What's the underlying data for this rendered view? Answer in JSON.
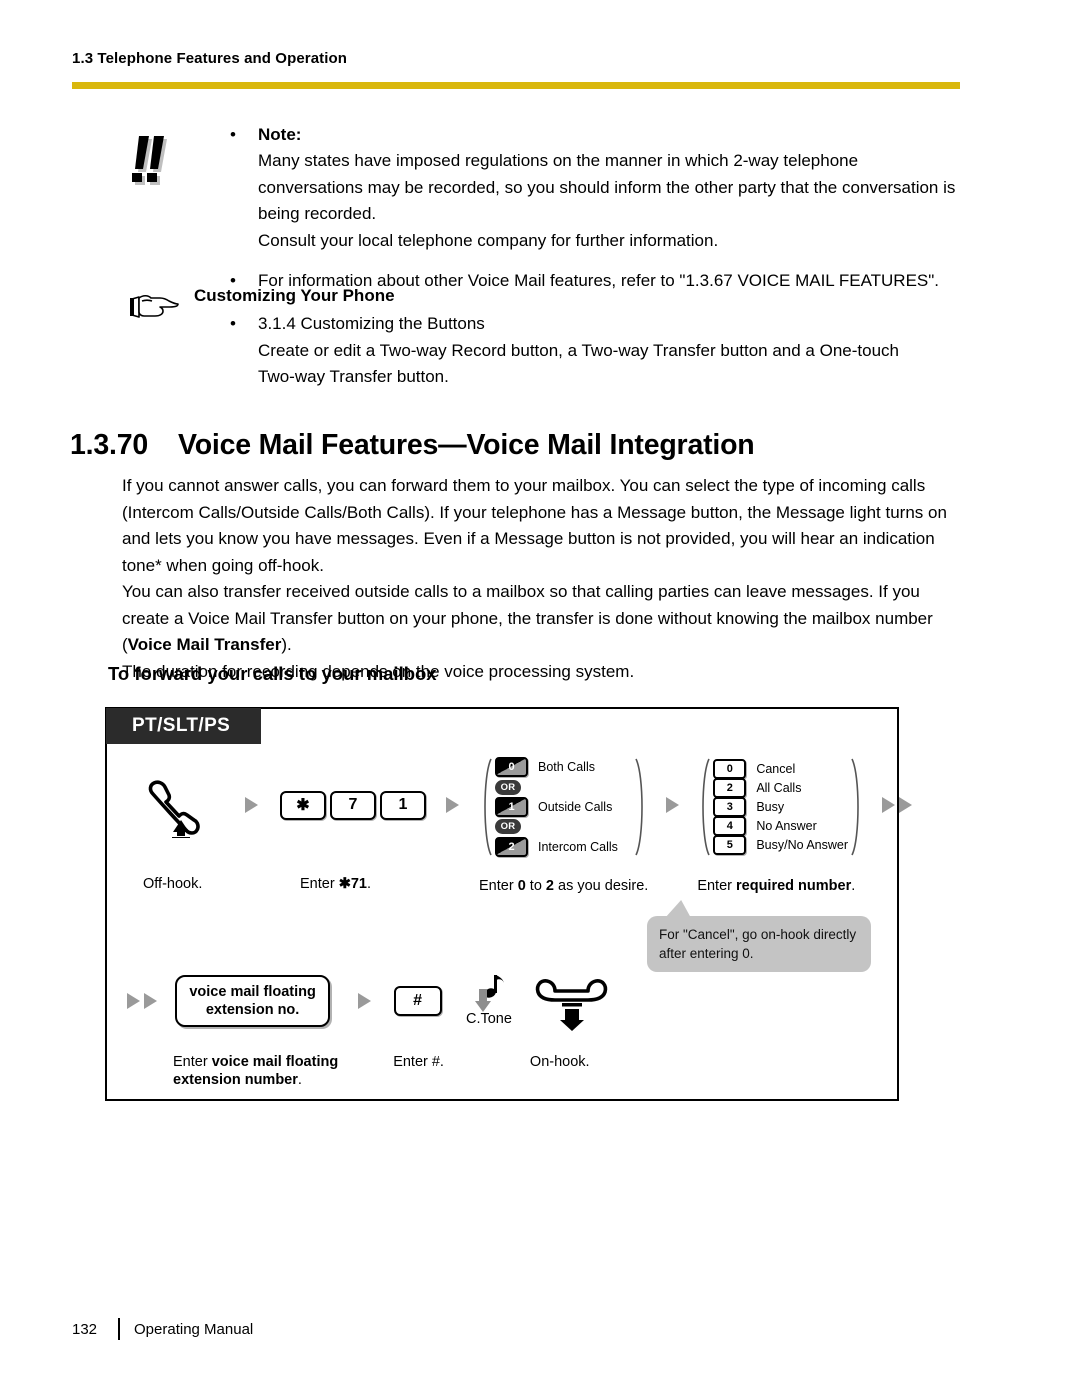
{
  "header": {
    "running_head": "1.3 Telephone Features and Operation",
    "rule_color": "#D9B70D"
  },
  "note": {
    "icon": "double-exclamation-icon",
    "bullet": "•",
    "heading": "Note:",
    "lines": [
      "Many states have imposed regulations on the manner in which 2-way telephone",
      "conversations may be recorded, so you should inform the other party that the conversation is",
      "being recorded.",
      "Consult your local telephone company for further information."
    ],
    "second_bullet": "For information about other Voice Mail features, refer to \"1.3.67 VOICE MAIL FEATURES\"."
  },
  "customizing": {
    "icon": "pointing-hand-icon",
    "heading": "Customizing Your Phone",
    "bullet": "•",
    "item": "3.1.4 Customizing the Buttons",
    "lines": [
      "Create or edit a Two-way Record button, a Two-way Transfer button and a One-touch",
      "Two-way Transfer button."
    ]
  },
  "section": {
    "number": "1.3.70",
    "title": "Voice Mail Features—Voice Mail Integration"
  },
  "intro": {
    "paragraphs": [
      "If you cannot answer calls, you can forward them to your mailbox. You can select the type of incoming calls (Intercom Calls/Outside Calls/Both Calls). If your telephone has a Message button, the Message light turns on and lets you know you have messages. Even if a Message button is not provided, you will hear an indication tone* when going off-hook.",
      "You can also transfer received outside calls to a mailbox so that calling parties can leave messages. If you create a Voice Mail Transfer button on your phone, the transfer is done without knowing the mailbox number",
      "The duration for recording depends on the voice processing system."
    ],
    "bold_term_open": "(",
    "bold_term": "Voice Mail Transfer",
    "bold_term_close": ")."
  },
  "subhead": "To forward your calls to your mailbox",
  "diagram": {
    "phone_type_tag": "PT/SLT/PS",
    "row1": {
      "step_offhook": {
        "icon": "handset-offhook-icon",
        "caption": "Off-hook."
      },
      "step_code": {
        "keys": [
          "✱",
          "7",
          "1"
        ],
        "caption_prefix": "Enter ",
        "caption_code": "✱71",
        "caption_suffix": "."
      },
      "step_calltype": {
        "options": [
          {
            "key": "0",
            "label": "Both Calls"
          },
          {
            "key": "OR",
            "label": ""
          },
          {
            "key": "1",
            "label": "Outside Calls"
          },
          {
            "key": "OR",
            "label": ""
          },
          {
            "key": "2",
            "label": "Intercom Calls"
          }
        ],
        "caption": "Enter 0 to 2 as you desire.",
        "caption_parts": [
          "Enter ",
          "0",
          " to ",
          "2",
          " as you desire."
        ]
      },
      "step_required": {
        "options": [
          {
            "key": "0",
            "label": "Cancel"
          },
          {
            "key": "2",
            "label": "All Calls"
          },
          {
            "key": "3",
            "label": "Busy"
          },
          {
            "key": "4",
            "label": "No Answer"
          },
          {
            "key": "5",
            "label": "Busy/No Answer"
          }
        ],
        "caption_prefix": "Enter ",
        "caption_bold": "required number",
        "caption_suffix": "."
      },
      "callout": "For \"Cancel\", go on-hook directly after entering 0."
    },
    "row2": {
      "step_vm": {
        "box_line1": "voice mail floating",
        "box_line2": "extension no.",
        "caption_prefix": "Enter ",
        "caption_bold_line1": "voice mail floating",
        "caption_bold_line2": "extension number",
        "caption_suffix": "."
      },
      "step_hash": {
        "key": "#",
        "caption": "Enter #."
      },
      "step_tone": {
        "icon": "confirmation-tone-icon",
        "label": "C.Tone"
      },
      "step_onhook": {
        "icon": "handset-onhook-icon",
        "caption": "On-hook."
      }
    }
  },
  "footer": {
    "page_number": "132",
    "manual_name": "Operating Manual"
  }
}
